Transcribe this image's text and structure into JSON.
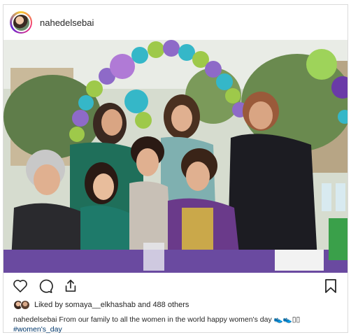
{
  "post": {
    "username": "nahedelsebai",
    "likes": {
      "prefix": "Liked by",
      "user": "somaya__elkhashab",
      "connector": "and",
      "others": "488 others"
    },
    "caption": {
      "username": "nahedelsebai",
      "text": "From our family to all the women in the world happy women's day 👟👟▯▯",
      "hashtag": "#women's_day"
    }
  },
  "icons": {
    "like": "heart-icon",
    "comment": "comment-icon",
    "share": "share-icon",
    "save": "bookmark-icon"
  },
  "colors": {
    "border": "#dbdbdb",
    "text": "#262626",
    "hashtag": "#00376b"
  }
}
